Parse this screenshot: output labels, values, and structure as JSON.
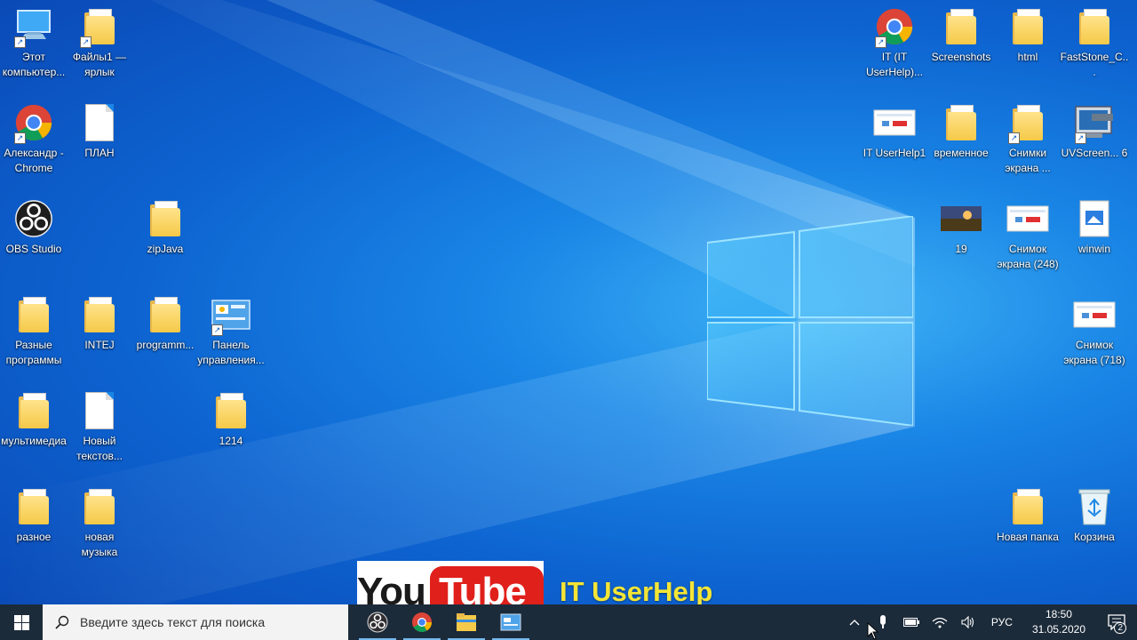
{
  "desktop": {
    "icons": [
      {
        "label": "Этот компьютер...",
        "kind": "computer"
      },
      {
        "label": "Файлы1 — ярлык",
        "kind": "folder"
      },
      {
        "label": "Александр - Chrome",
        "kind": "chrome"
      },
      {
        "label": "ПЛАН",
        "kind": "doc"
      },
      {
        "label": "OBS Studio",
        "kind": "obs"
      },
      {
        "label": "zipJava",
        "kind": "folder"
      },
      {
        "label": "Разные программы",
        "kind": "folder"
      },
      {
        "label": "INTEJ",
        "kind": "folder"
      },
      {
        "label": "programm...",
        "kind": "folder-pdf"
      },
      {
        "label": "Панель управления...",
        "kind": "control-panel"
      },
      {
        "label": "мультимедиа",
        "kind": "folder"
      },
      {
        "label": "Новый текстов...",
        "kind": "doc"
      },
      {
        "label": "1214",
        "kind": "folder"
      },
      {
        "label": "разное",
        "kind": "folder"
      },
      {
        "label": "новая музыка",
        "kind": "folder"
      },
      {
        "label": "IT (IT UserHelp)...",
        "kind": "chrome"
      },
      {
        "label": "Screenshots",
        "kind": "folder"
      },
      {
        "label": "html",
        "kind": "folder"
      },
      {
        "label": "FastStone_C...",
        "kind": "folder"
      },
      {
        "label": "IT UserHelp1",
        "kind": "image"
      },
      {
        "label": "временное",
        "kind": "folder-pdf"
      },
      {
        "label": "Снимки экрана ...",
        "kind": "folder"
      },
      {
        "label": "UVScreen... 6",
        "kind": "app"
      },
      {
        "label": "19",
        "kind": "photo"
      },
      {
        "label": "Снимок экрана (248)",
        "kind": "image"
      },
      {
        "label": "winwin",
        "kind": "doc-image"
      },
      {
        "label": "Снимок экрана (718)",
        "kind": "image"
      },
      {
        "label": "Новая папка",
        "kind": "folder"
      },
      {
        "label": "Корзина",
        "kind": "recycle-bin"
      }
    ]
  },
  "banner": {
    "you": "You",
    "tube": "Tube",
    "brand": "IT UserHelp"
  },
  "taskbar": {
    "search_placeholder": "Введите здесь текст для поиска",
    "language": "РУС",
    "time": "18:50",
    "date": "31.05.2020",
    "notification_count": "2"
  },
  "colors": {
    "taskbar": "#1c2b3a",
    "banner_brand": "#f4e536",
    "youtube_red": "#e0201b"
  }
}
